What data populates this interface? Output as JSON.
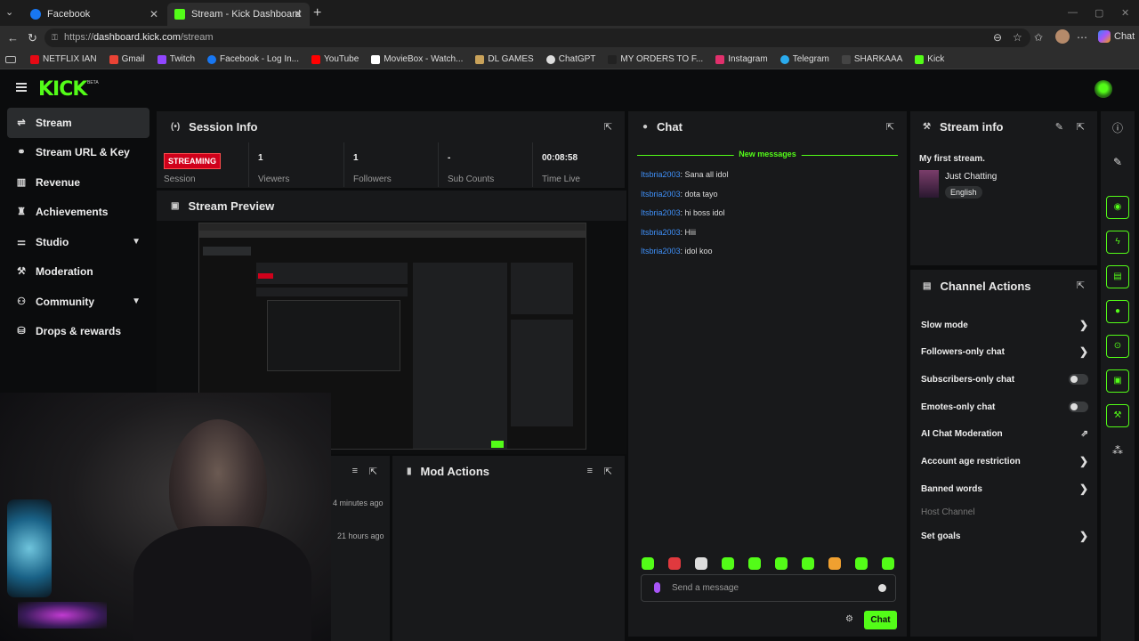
{
  "browser": {
    "tabs": [
      {
        "title": "Facebook",
        "color": "#1877f2"
      },
      {
        "title": "Stream - Kick Dashboard",
        "color": "#53fc18"
      }
    ],
    "new_tab": "+",
    "url_prefix": "https://",
    "url_host": "dashboard.kick.com",
    "url_path": "/stream",
    "copilot_label": "Chat",
    "bookmarks": [
      {
        "label": "NETFLIX IAN",
        "color": "#e50914"
      },
      {
        "label": "Gmail",
        "color": "#ea4335"
      },
      {
        "label": "Twitch",
        "color": "#9146ff"
      },
      {
        "label": "Facebook - Log In...",
        "color": "#1877f2"
      },
      {
        "label": "YouTube",
        "color": "#ff0000"
      },
      {
        "label": "MovieBox - Watch...",
        "color": "#ffffff"
      },
      {
        "label": "DL GAMES",
        "color": "#c9a25a"
      },
      {
        "label": "ChatGPT",
        "color": "#dddddd"
      },
      {
        "label": "MY ORDERS TO F...",
        "color": "#222222"
      },
      {
        "label": "Instagram",
        "color": "#e1306c"
      },
      {
        "label": "Telegram",
        "color": "#2aabee"
      },
      {
        "label": "SHARKAAA",
        "color": "#444444"
      },
      {
        "label": "Kick",
        "color": "#53fc18"
      }
    ]
  },
  "app": {
    "logo": "KICK",
    "logo_badge": "BETA",
    "sidebar": [
      {
        "label": "Stream",
        "icon": "broadcast-icon",
        "glyph": "⇌",
        "active": true
      },
      {
        "label": "Stream URL & Key",
        "icon": "link-icon",
        "glyph": "⚭"
      },
      {
        "label": "Revenue",
        "icon": "chart-icon",
        "glyph": "▥"
      },
      {
        "label": "Achievements",
        "icon": "trophy-icon",
        "glyph": "♜"
      },
      {
        "label": "Studio",
        "icon": "sliders-icon",
        "glyph": "⚌",
        "chevron": true
      },
      {
        "label": "Moderation",
        "icon": "wrench-icon",
        "glyph": "⚒"
      },
      {
        "label": "Community",
        "icon": "people-icon",
        "glyph": "⚇",
        "chevron": true
      },
      {
        "label": "Drops & rewards",
        "icon": "gift-icon",
        "glyph": "⛁"
      }
    ],
    "session": {
      "title": "Session Info",
      "status_badge": "STREAMING",
      "session_label": "Session",
      "stats": [
        {
          "value": "1",
          "label": "Viewers"
        },
        {
          "value": "1",
          "label": "Followers"
        },
        {
          "value": "-",
          "label": "Sub Counts"
        },
        {
          "value": "00:08:58",
          "label": "Time Live"
        }
      ]
    },
    "preview": {
      "title": "Stream Preview"
    },
    "mod_actions": {
      "title": "Mod Actions"
    },
    "activity": {
      "times": [
        "4 minutes ago",
        "21 hours ago"
      ]
    },
    "chat": {
      "title": "Chat",
      "new_messages": "New messages",
      "messages": [
        {
          "user": "Itsbria2003",
          "text": ": Sana all idol"
        },
        {
          "user": "Itsbria2003",
          "text": ": dota tayo"
        },
        {
          "user": "Itsbria2003",
          "text": ": hi boss idol"
        },
        {
          "user": "Itsbria2003",
          "text": ": Hiii"
        },
        {
          "user": "Itsbria2003",
          "text": ": idol koo"
        }
      ],
      "placeholder": "Send a message",
      "send_label": "Chat",
      "emote_colors": [
        "#53fc18",
        "#e0393e",
        "#dddddd",
        "#53fc18",
        "#53fc18",
        "#53fc18",
        "#53fc18",
        "#f0a030",
        "#53fc18",
        "#53fc18"
      ]
    },
    "stream_info": {
      "title": "Stream info",
      "stream_title": "My first stream.",
      "category": "Just Chatting",
      "language": "English"
    },
    "channel_actions": {
      "title": "Channel Actions",
      "items": [
        {
          "label": "Slow mode",
          "control": "arrow"
        },
        {
          "label": "Followers-only chat",
          "control": "arrow"
        },
        {
          "label": "Subscribers-only chat",
          "control": "toggle"
        },
        {
          "label": "Emotes-only chat",
          "control": "toggle"
        },
        {
          "label": "AI Chat Moderation",
          "control": "external"
        },
        {
          "label": "Account age restriction",
          "control": "arrow"
        },
        {
          "label": "Banned words",
          "control": "arrow"
        },
        {
          "label": "Host Channel",
          "control": "none",
          "disabled": true
        },
        {
          "label": "Set goals",
          "control": "arrow"
        }
      ]
    }
  }
}
